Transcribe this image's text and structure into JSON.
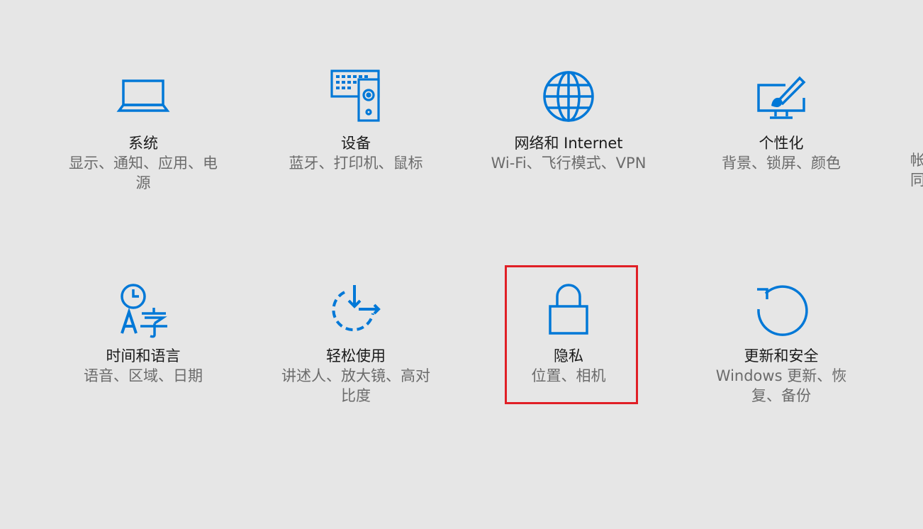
{
  "accent_color": "#0078d7",
  "highlight_color": "#e01f26",
  "tiles": [
    {
      "title": "系统",
      "desc": "显示、通知、应用、电源",
      "icon": "laptop-icon"
    },
    {
      "title": "设备",
      "desc": "蓝牙、打印机、鼠标",
      "icon": "devices-icon"
    },
    {
      "title": "网络和 Internet",
      "desc": "Wi-Fi、飞行模式、VPN",
      "icon": "globe-icon"
    },
    {
      "title": "个性化",
      "desc": "背景、锁屏、颜色",
      "icon": "personalization-icon"
    },
    {
      "title": "时间和语言",
      "desc": "语音、区域、日期",
      "icon": "time-language-icon"
    },
    {
      "title": "轻松使用",
      "desc": "讲述人、放大镜、高对比度",
      "icon": "ease-of-access-icon"
    },
    {
      "title": "隐私",
      "desc": "位置、相机",
      "icon": "lock-icon"
    },
    {
      "title": "更新和安全",
      "desc": "Windows 更新、恢复、备份",
      "icon": "update-icon"
    }
  ],
  "partial_tile": {
    "line1": "帐",
    "line2": "同"
  }
}
